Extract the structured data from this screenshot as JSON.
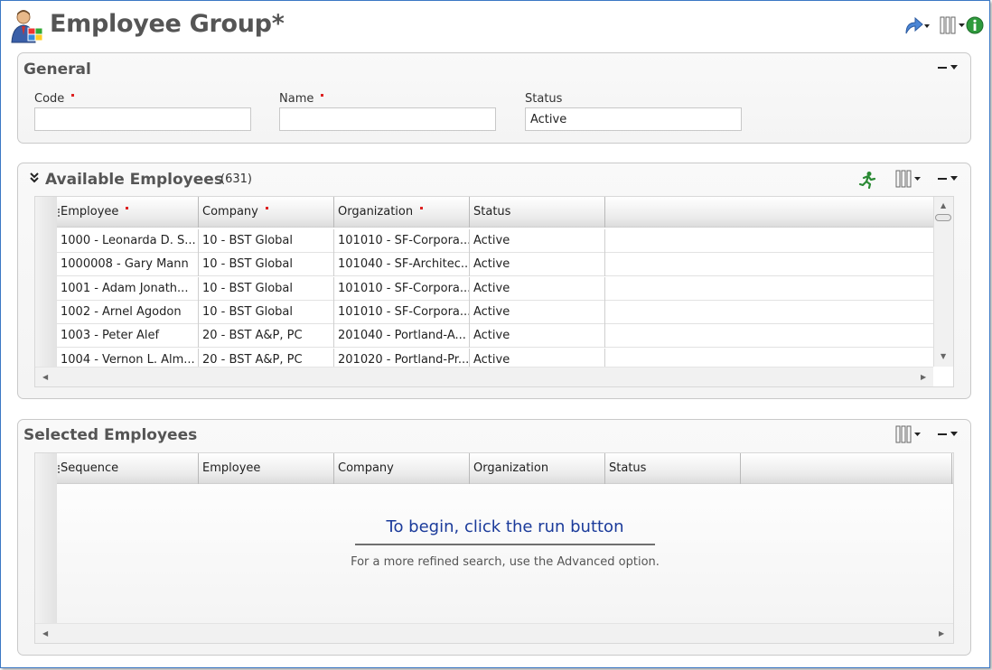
{
  "header": {
    "title": "Employee Group*",
    "icons": [
      "employee-group-icon",
      "share-icon",
      "columns-icon",
      "info-icon"
    ]
  },
  "general": {
    "title": "General",
    "fields": {
      "code": {
        "label": "Code",
        "value": ""
      },
      "name": {
        "label": "Name",
        "value": ""
      },
      "status": {
        "label": "Status",
        "value": "Active"
      }
    }
  },
  "available": {
    "title": "Available Employees",
    "count": "(631)",
    "columns": [
      "Employee",
      "Company",
      "Organization",
      "Status"
    ],
    "rows": [
      [
        "1000 - Leonarda D. S...",
        "10 - BST Global",
        "101010 - SF-Corpora...",
        "Active"
      ],
      [
        "1000008 - Gary Mann",
        "10 - BST Global",
        "101040 - SF-Architec...",
        "Active"
      ],
      [
        "1001 - Adam Jonath...",
        "10 - BST Global",
        "101010 - SF-Corpora...",
        "Active"
      ],
      [
        "1002 - Arnel Agodon",
        "10 - BST Global",
        "101010 - SF-Corpora...",
        "Active"
      ],
      [
        "1003 - Peter Alef",
        "20 - BST A&P, PC",
        "201040 - Portland-A...",
        "Active"
      ],
      [
        "1004 - Vernon L. Alm...",
        "20 - BST A&P, PC",
        "201020 - Portland-Pr...",
        "Active"
      ]
    ]
  },
  "selected": {
    "title": "Selected Employees",
    "columns": [
      "Sequence",
      "Employee",
      "Company",
      "Organization",
      "Status"
    ],
    "empty_message": "To begin, click the run button",
    "empty_sub": "For a more refined search, use the Advanced option."
  },
  "colors": {
    "accent_border": "#3b78c4",
    "required": "#dd2222",
    "run_message": "#1a3a9a"
  }
}
